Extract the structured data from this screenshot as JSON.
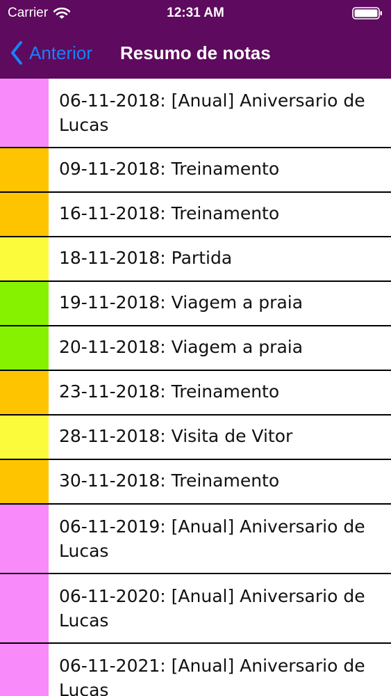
{
  "status_bar": {
    "carrier": "Carrier",
    "time": "12:31 AM",
    "wifi_icon": "wifi-icon",
    "battery_icon": "battery-full-icon"
  },
  "nav": {
    "back_label": "Anterior",
    "back_icon": "chevron-left-icon",
    "title": "Resumo de notas",
    "background_color": "#5e0a5e",
    "accent_color": "#1982fb"
  },
  "notes": [
    {
      "text": "06-11-2018: [Anual] Aniversario de Lucas",
      "color": "#f98af9"
    },
    {
      "text": "09-11-2018: Treinamento",
      "color": "#ffc400"
    },
    {
      "text": "16-11-2018: Treinamento",
      "color": "#ffc400"
    },
    {
      "text": "18-11-2018: Partida",
      "color": "#fbfb3c"
    },
    {
      "text": "19-11-2018: Viagem a praia",
      "color": "#87f200"
    },
    {
      "text": "20-11-2018: Viagem a praia",
      "color": "#87f200"
    },
    {
      "text": "23-11-2018: Treinamento",
      "color": "#ffc400"
    },
    {
      "text": "28-11-2018: Visita de Vitor",
      "color": "#fbfb3c"
    },
    {
      "text": "30-11-2018: Treinamento",
      "color": "#ffc400"
    },
    {
      "text": "06-11-2019: [Anual] Aniversario de Lucas",
      "color": "#f98af9"
    },
    {
      "text": "06-11-2020: [Anual] Aniversario de Lucas",
      "color": "#f98af9"
    },
    {
      "text": "06-11-2021: [Anual] Aniversario de Lucas",
      "color": "#f98af9"
    }
  ]
}
